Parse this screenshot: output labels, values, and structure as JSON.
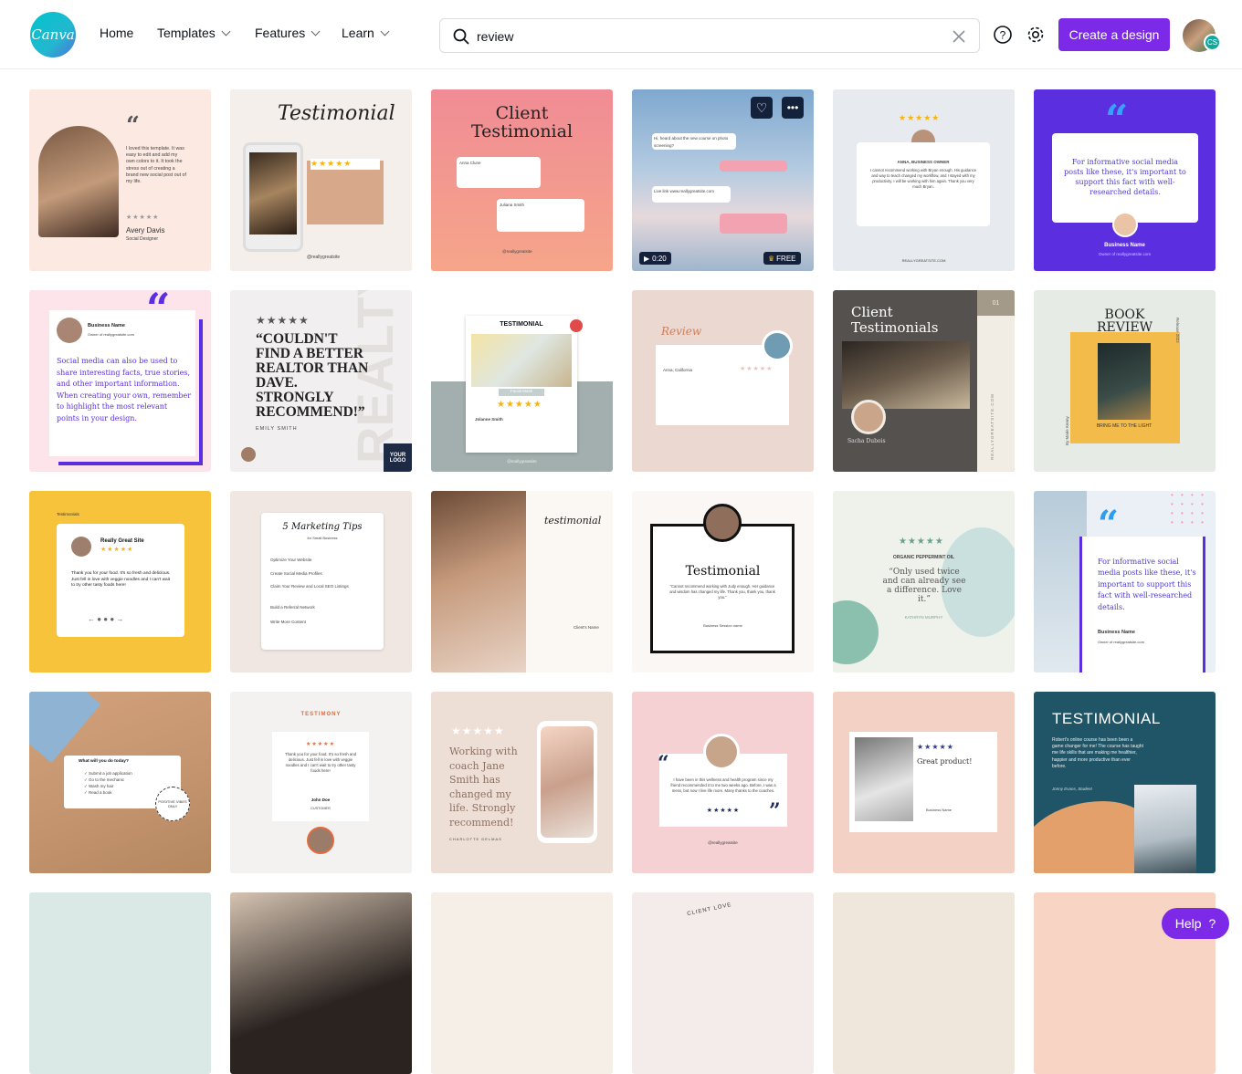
{
  "header": {
    "logo_text": "Canva",
    "nav": [
      {
        "label": "Home"
      },
      {
        "label": "Templates"
      },
      {
        "label": "Features"
      },
      {
        "label": "Learn"
      }
    ],
    "search_value": "review",
    "create_label": "Create a design",
    "avatar_initials": "CS"
  },
  "cards": {
    "c1": {
      "body": "I loved this template. It was easy to edit and add my own colors to it. It took the stress out of creating a brand new social post out of my life.",
      "name": "Avery Davis",
      "role": "Social Designer"
    },
    "c2": {
      "title": "Testimonial",
      "handle": "@reallygreatsite"
    },
    "c3": {
      "title1": "Client",
      "title2": "Testimonial",
      "n1": "Anna Clune",
      "n2": "Juliana Smith",
      "handle": "@reallygreatsite"
    },
    "c4": {
      "duration": "0:20",
      "badge": "FREE",
      "m1": "Hi, heard about the new course on photo screening?",
      "m2": "Live link www.reallygreatsite.com"
    },
    "c5": {
      "name": "ANNA, BUSINESS OWNER",
      "body": "I cannot recommend working with Bryan enough. His guidance and way to teach changed my workflow, and I stayed with my productivity. I will be working with him again. Thank you very much Bryan.",
      "site": "REALLYGREATSITE.COM"
    },
    "c6": {
      "body": "For informative social media posts like these, it's important to support this fact with well-researched details.",
      "name": "Business Name",
      "sub": "Owner of reallygreatsite.com"
    },
    "c7": {
      "name": "Business Name",
      "sub": "Owner of reallygreatsite.com",
      "body": "Social media can also be used to share interesting facts, true stories, and other important information. When creating your own, remember to highlight the most relevant points in your design."
    },
    "c8": {
      "quote": "“COULDN'T FIND A BETTER REALTOR THAN DAVE. STRONGLY RECOMMEND!”",
      "name": "EMILY SMITH",
      "logo": "YOUR LOGO",
      "bg": "REALTY"
    },
    "c9": {
      "title": "TESTIMONIAL",
      "label": "Facial Mask",
      "name": "Jolanne Smith",
      "handle": "@reallygreatsite"
    },
    "c10": {
      "title": "Review",
      "name": "Anna, California"
    },
    "c11": {
      "title1": "Client",
      "title2": "Testimonials",
      "num": "01",
      "name": "Sacha Dubois",
      "side": "REALLYGREATSITE.COM"
    },
    "c12": {
      "title1": "BOOK",
      "title2": "REVIEW",
      "book": "BRING ME TO THE LIGHT",
      "side1": "Release 2022",
      "side2": "By Marie Kenny"
    },
    "c13": {
      "tag": "Testimonials",
      "title": "Really Great Site",
      "body": "Thank you for your food. It's so fresh and delicious. Just fell in love with veggie noodles and I can't wait to try other tasty foods here!"
    },
    "c14": {
      "title": "5 Marketing Tips",
      "sub": "for Small Business",
      "items": [
        "Optimize Your Website",
        "Create Social Media Profiles",
        "Claim Your Review and Local SEO Listings",
        "Build a Referral Network",
        "Write More Content"
      ]
    },
    "c15": {
      "title": "testimonial",
      "client": "Client's Name"
    },
    "c16": {
      "title": "Testimonial",
      "body": "“Cannot recommend working with Judy enough. Her guidance and wisdom has changed my life. Thank you, thank you, thank you.”",
      "name": "Business Session name"
    },
    "c17": {
      "label": "ORGANIC PEPPERMINT OIL",
      "quote": "“Only used twice and can already see a difference. Love it.”",
      "name": "KATHRYN MURPHY"
    },
    "c18": {
      "body": "For informative social media posts like these, it's important to support this fact with well-researched details.",
      "name": "Business Name",
      "sub": "Owner of reallygreatsite.com"
    },
    "c19": {
      "question": "What will you do today?",
      "items": [
        "Submit a job application",
        "Go to the mechanic",
        "Wash my hair",
        "Read a book"
      ],
      "stamp": "POSITIVE VIBES ONLY"
    },
    "c20": {
      "title": "TESTIMONY",
      "body": "Thank you for your food. It's so fresh and delicious. Just fell in love with veggie noodles and I can't wait to try other tasty foods here!",
      "name": "John Doe",
      "role": "CUSTOMER"
    },
    "c21": {
      "body": "Working with coach Jane Smith has changed my life. Strongly recommend!",
      "name": "CHARLOTTE DELMAS"
    },
    "c22": {
      "body": "I have been in this wellness and health program since my friend recommended it to me two weeks ago. Before, I was a mess, but now I live life more. Many thanks to the coaches.",
      "handle": "@reallygreatsite"
    },
    "c23": {
      "title": "Great product!",
      "name": "Business Name"
    },
    "c24": {
      "title": "TESTIMONIAL",
      "body": "Robert's online course has been been a game changer for me! The course has taught me life skills that are making me healthier, happier and more productive than ever before.",
      "name": "Jonny Evans, Student"
    }
  },
  "bottom": {
    "circle_text": "CLIENT LOVE"
  },
  "help": {
    "label": "Help",
    "icon": "?"
  }
}
